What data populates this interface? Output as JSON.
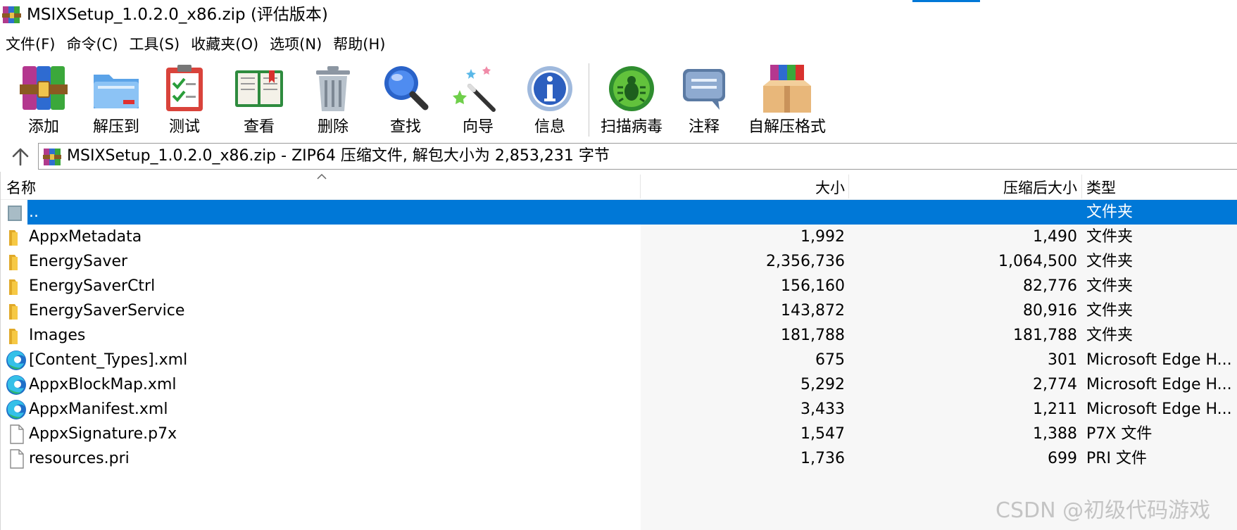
{
  "window": {
    "title": "MSIXSetup_1.0.2.0_x86.zip (评估版本)"
  },
  "menu": [
    "文件(F)",
    "命令(C)",
    "工具(S)",
    "收藏夹(O)",
    "选项(N)",
    "帮助(H)"
  ],
  "toolbar": {
    "add": "添加",
    "extract": "解压到",
    "test": "测试",
    "view": "查看",
    "delete": "删除",
    "find": "查找",
    "wizard": "向导",
    "info": "信息",
    "scan": "扫描病毒",
    "comment": "注释",
    "sfx": "自解压格式"
  },
  "address": {
    "text": "MSIXSetup_1.0.2.0_x86.zip - ZIP64 压缩文件, 解包大小为 2,853,231 字节"
  },
  "columns": {
    "name": "名称",
    "size": "大小",
    "packed": "压缩后大小",
    "type": "类型"
  },
  "rows": [
    {
      "name": "..",
      "size": "",
      "packed": "",
      "type": "文件夹",
      "icon": "parent-folder-icon"
    },
    {
      "name": "AppxMetadata",
      "size": "1,992",
      "packed": "1,490",
      "type": "文件夹",
      "icon": "folder-icon"
    },
    {
      "name": "EnergySaver",
      "size": "2,356,736",
      "packed": "1,064,500",
      "type": "文件夹",
      "icon": "folder-icon"
    },
    {
      "name": "EnergySaverCtrl",
      "size": "156,160",
      "packed": "82,776",
      "type": "文件夹",
      "icon": "folder-icon"
    },
    {
      "name": "EnergySaverService",
      "size": "143,872",
      "packed": "80,916",
      "type": "文件夹",
      "icon": "folder-icon"
    },
    {
      "name": "Images",
      "size": "181,788",
      "packed": "181,788",
      "type": "文件夹",
      "icon": "folder-icon"
    },
    {
      "name": "[Content_Types].xml",
      "size": "675",
      "packed": "301",
      "type": "Microsoft Edge H...",
      "icon": "edge-icon"
    },
    {
      "name": "AppxBlockMap.xml",
      "size": "5,292",
      "packed": "2,774",
      "type": "Microsoft Edge H...",
      "icon": "edge-icon"
    },
    {
      "name": "AppxManifest.xml",
      "size": "3,433",
      "packed": "1,211",
      "type": "Microsoft Edge H...",
      "icon": "edge-icon"
    },
    {
      "name": "AppxSignature.p7x",
      "size": "1,547",
      "packed": "1,388",
      "type": "P7X 文件",
      "icon": "file-icon"
    },
    {
      "name": "resources.pri",
      "size": "1,736",
      "packed": "699",
      "type": "PRI 文件",
      "icon": "file-icon"
    }
  ],
  "watermark": "CSDN @初级代码游戏",
  "colors": {
    "selection": "#0078d7",
    "folder": "#f0c243"
  }
}
